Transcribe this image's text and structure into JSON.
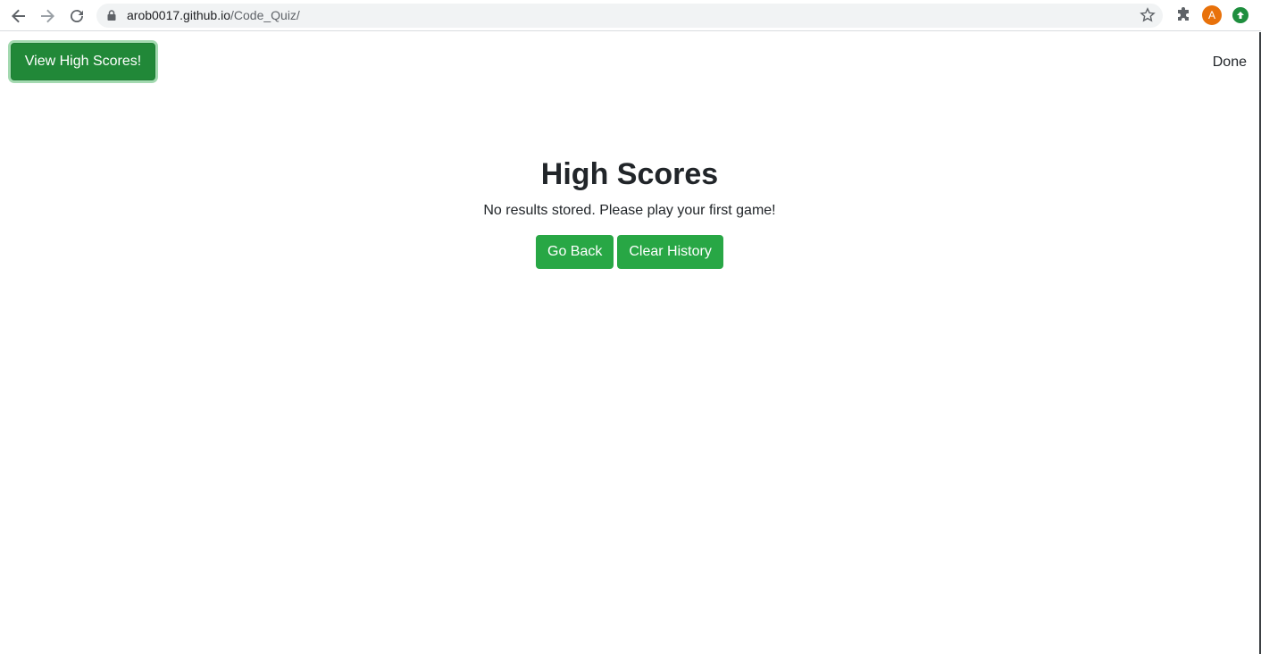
{
  "browser": {
    "url_host": "arob0017.github.io",
    "url_path": "/Code_Quiz/",
    "avatar_letter": "A",
    "icons": [
      "back-arrow-icon",
      "forward-arrow-icon",
      "reload-icon",
      "lock-icon",
      "bookmark-star-icon",
      "extensions-puzzle-icon",
      "profile-avatar",
      "extension-green-icon"
    ]
  },
  "header": {
    "view_high_scores_label": "View High Scores!",
    "timer_text": "Done"
  },
  "main": {
    "title": "High Scores",
    "message": "No results stored. Please play your first game!",
    "go_back_label": "Go Back",
    "clear_history_label": "Clear History"
  },
  "colors": {
    "button_green": "#28a745",
    "button_green_active": "#218838",
    "avatar_orange": "#e8710a"
  }
}
